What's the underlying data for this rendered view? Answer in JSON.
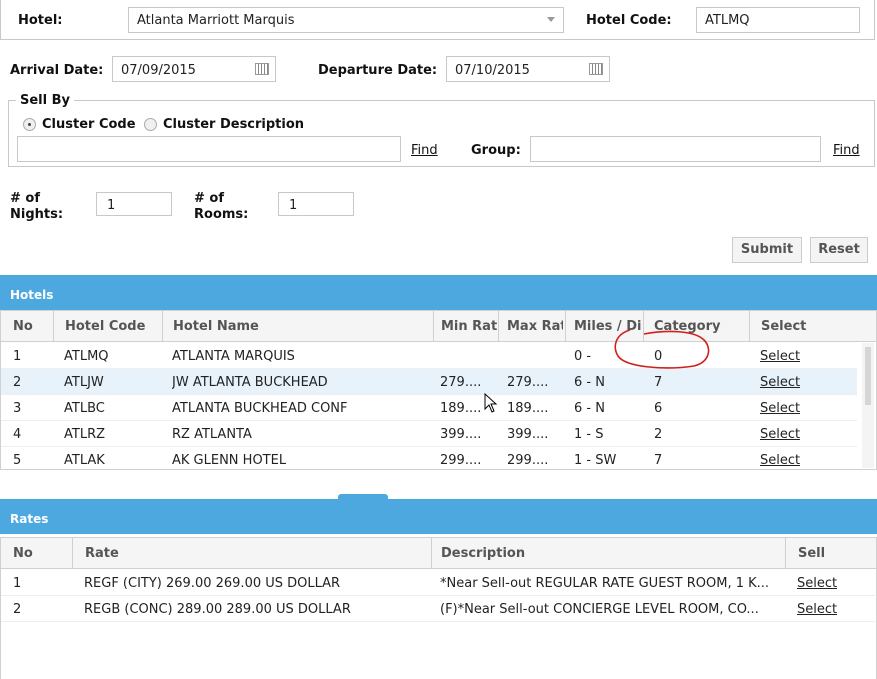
{
  "form": {
    "hotel_label": "Hotel:",
    "hotel_value": "Atlanta Marriott Marquis",
    "hotel_code_label": "Hotel Code:",
    "hotel_code_value": "ATLMQ",
    "arrival_label": "Arrival Date:",
    "arrival_value": "07/09/2015",
    "departure_label": "Departure Date:",
    "departure_value": "07/10/2015",
    "sell_by_legend": "Sell By",
    "radio_cluster_code": "Cluster Code",
    "radio_cluster_desc": "Cluster Description",
    "cluster_input_value": "",
    "find_label": "Find",
    "group_label": "Group:",
    "group_value": "",
    "find2_label": "Find",
    "nights_label_1": "# of",
    "nights_label_2": "Nights:",
    "nights_value": "1",
    "rooms_label_1": "# of",
    "rooms_label_2": "Rooms:",
    "rooms_value": "1",
    "submit_label": "Submit",
    "reset_label": "Reset"
  },
  "hotels": {
    "title": "Hotels",
    "columns": [
      "No",
      "Hotel Code",
      "Hotel Name",
      "Min Rate",
      "Max Rate",
      "Miles / Direction",
      "Category",
      "Select"
    ],
    "rows": [
      {
        "no": "1",
        "code": "ATLMQ",
        "name": "ATLANTA MARQUIS",
        "min": "",
        "max": "",
        "miles": "0 -",
        "cat": "0",
        "select": "Select"
      },
      {
        "no": "2",
        "code": "ATLJW",
        "name": "JW ATLANTA BUCKHEAD",
        "min": "279....",
        "max": "279....",
        "miles": "6 - N",
        "cat": "7",
        "select": "Select"
      },
      {
        "no": "3",
        "code": "ATLBC",
        "name": "ATLANTA BUCKHEAD CONF",
        "min": "189....",
        "max": "189....",
        "miles": "6 - N",
        "cat": "6",
        "select": "Select"
      },
      {
        "no": "4",
        "code": "ATLRZ",
        "name": "RZ ATLANTA",
        "min": "399....",
        "max": "399....",
        "miles": "1 - S",
        "cat": "2",
        "select": "Select"
      },
      {
        "no": "5",
        "code": "ATLAK",
        "name": "AK GLENN HOTEL",
        "min": "299....",
        "max": "299....",
        "miles": "1 - SW",
        "cat": "7",
        "select": "Select"
      }
    ]
  },
  "rates": {
    "title": "Rates",
    "columns": [
      "No",
      "Rate",
      "Description",
      "Sell"
    ],
    "rows": [
      {
        "no": "1",
        "rate": "REGF (CITY) 269.00 269.00 US DOLLAR",
        "desc": "*Near Sell-out REGULAR RATE GUEST ROOM, 1 K...",
        "sell": "Select"
      },
      {
        "no": "2",
        "rate": "REGB (CONC) 289.00 289.00 US DOLLAR",
        "desc": "(F)*Near Sell-out CONCIERGE LEVEL ROOM, CO...",
        "sell": "Select"
      }
    ]
  },
  "colors": {
    "header_bar": "#4ea8e0",
    "highlight_row": "#e8f2fa",
    "annotation": "#d0201b"
  }
}
